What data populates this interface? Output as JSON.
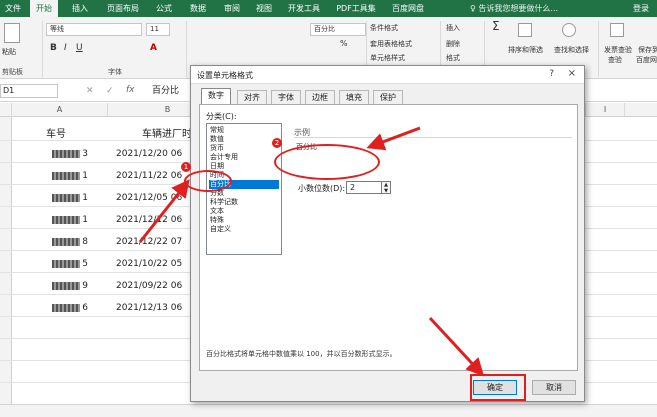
{
  "ribbon_tabs": [
    "文件",
    "开始",
    "插入",
    "页面布局",
    "公式",
    "数据",
    "审阅",
    "视图",
    "开发工具",
    "PDF工具集",
    "百度网盘"
  ],
  "active_tab": "开始",
  "tell_me": "告诉我您想要做什么...",
  "login": "登录",
  "ribbon": {
    "paste": "粘贴",
    "clipboard": "剪贴板",
    "font_name": "等线",
    "font_size": "11",
    "font_group": "字体",
    "number_format": "百分比",
    "conditional_format": "条件格式",
    "table_format": "套用表格格式",
    "cell_style": "单元格样式",
    "insert": "插入",
    "delete": "删除",
    "format": "格式",
    "sort_filter": "排序和筛选",
    "find_select": "查找和选择",
    "invoice_check": "发票查验",
    "baidu_save_1": "保存到",
    "baidu_save_2": "百度网盘",
    "invoice_check_2": "查验"
  },
  "formula_bar": {
    "name_box": "D1",
    "fx": "fx",
    "value": "百分比"
  },
  "columns": [
    "A",
    "B"
  ],
  "rows": [
    {
      "a_suffix": "",
      "a": "车号",
      "b": "车辆进厂时"
    },
    {
      "a_suffix": "3",
      "b": "2021/12/20 06"
    },
    {
      "a_suffix": "1",
      "b": "2021/11/22 06"
    },
    {
      "a_suffix": "1",
      "b": "2021/12/05 06"
    },
    {
      "a_suffix": "1",
      "b": "2021/12/12 06"
    },
    {
      "a_suffix": "8",
      "b": "2021/12/22 07"
    },
    {
      "a_suffix": "5",
      "b": "2021/10/22 05"
    },
    {
      "a_suffix": "9",
      "b": "2021/09/22 06"
    },
    {
      "a_suffix": "6",
      "b": "2021/12/13 06"
    }
  ],
  "dialog": {
    "title": "设置单元格格式",
    "help": "?",
    "close": "×",
    "tabs": [
      "数字",
      "对齐",
      "字体",
      "边框",
      "填充",
      "保护"
    ],
    "active_tab": "数字",
    "category_label": "分类(C):",
    "categories": [
      "常规",
      "数值",
      "货币",
      "会计专用",
      "日期",
      "时间",
      "百分比",
      "分数",
      "科学记数",
      "文本",
      "特殊",
      "自定义"
    ],
    "selected_category": "百分比",
    "sample_label": "示例",
    "sample_value": "百分比",
    "decimal_label": "小数位数(D):",
    "decimal_value": "2",
    "description": "百分比格式将单元格中数值乘以 100，并以百分数形式显示。",
    "ok": "确定",
    "cancel": "取消"
  },
  "annotations": {
    "badge_1": "1",
    "badge_2": "2",
    "color": "#e02020"
  }
}
